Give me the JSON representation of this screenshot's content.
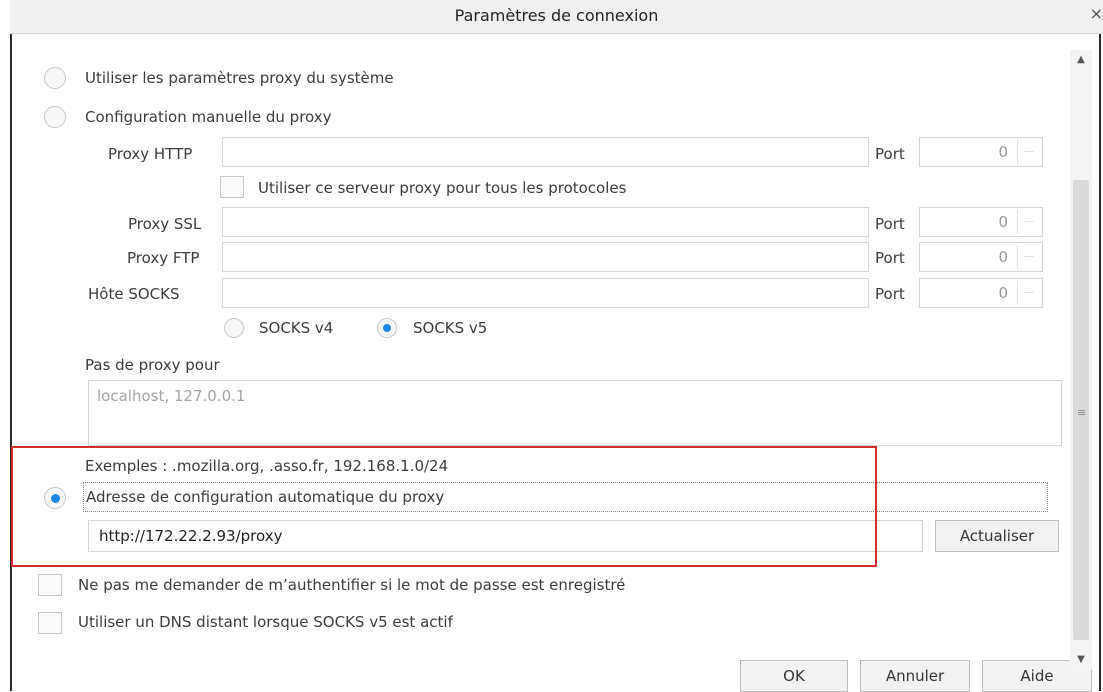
{
  "window": {
    "title": "Paramètres de connexion",
    "close_glyph": "×"
  },
  "options": {
    "system_proxy": "Utiliser les paramètres proxy du système",
    "manual_proxy": "Configuration manuelle du proxy",
    "auto_config": "Adresse de configuration automatique du proxy"
  },
  "proxy_rows": {
    "http_label": "Proxy HTTP",
    "ssl_label": "Proxy SSL",
    "ftp_label": "Proxy FTP",
    "socks_label": "Hôte SOCKS",
    "port_label": "Port",
    "http_port": "0",
    "ssl_port": "0",
    "ftp_port": "0",
    "socks_port": "0"
  },
  "use_all_protocols": "Utiliser ce serveur proxy pour tous les protocoles",
  "socks": {
    "v4": "SOCKS v4",
    "v5": "SOCKS v5",
    "selected": "v5"
  },
  "no_proxy": {
    "label": "Pas de proxy pour",
    "placeholder": "localhost, 127.0.0.1",
    "examples": "Exemples : .mozilla.org, .asso.fr, 192.168.1.0/24"
  },
  "auto_url": "http://172.22.2.93/proxy",
  "reload_button": "Actualiser",
  "checkboxes": {
    "no_auth_prompt": "Ne pas me demander de m’authentifier si le mot de passe est enregistré",
    "remote_dns": "Utiliser un DNS distant lorsque SOCKS v5 est actif"
  },
  "buttons": {
    "ok": "OK",
    "cancel": "Annuler",
    "help": "Aide"
  },
  "selected_mode": "auto_config",
  "colors": {
    "radio_selected": "#1e88e5",
    "highlight_box": "#d02c2c"
  },
  "icons": {
    "scroll_up": "▲",
    "scroll_down": "▼",
    "grip": "≡"
  }
}
